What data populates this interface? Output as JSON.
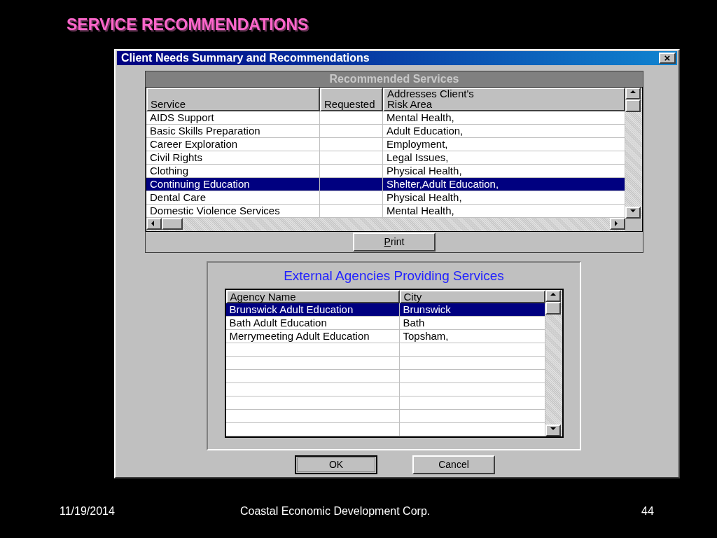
{
  "slide": {
    "title": "SERVICE RECOMMENDATIONS",
    "footer_date": "11/19/2014",
    "footer_org": "Coastal Economic Development Corp.",
    "footer_page": "44"
  },
  "window": {
    "title": "Client Needs Summary and Recommendations",
    "close": "×"
  },
  "services": {
    "heading": "Recommended Services",
    "columns": [
      "Service",
      "Requested",
      "Addresses Client's\nRisk Area"
    ],
    "rows": [
      {
        "cells": [
          "AIDS Support",
          "",
          "Mental Health,"
        ],
        "selected": false
      },
      {
        "cells": [
          "Basic Skills Preparation",
          "",
          "Adult Education,"
        ],
        "selected": false
      },
      {
        "cells": [
          "Career Exploration",
          "",
          "Employment,"
        ],
        "selected": false
      },
      {
        "cells": [
          "Civil Rights",
          "",
          "Legal Issues,"
        ],
        "selected": false
      },
      {
        "cells": [
          "Clothing",
          "",
          "Physical Health,"
        ],
        "selected": false
      },
      {
        "cells": [
          "Continuing Education",
          "",
          "Shelter,Adult Education,"
        ],
        "selected": true
      },
      {
        "cells": [
          "Dental Care",
          "",
          "Physical Health,"
        ],
        "selected": false
      },
      {
        "cells": [
          "Domestic Violence Services",
          "",
          "Mental Health,"
        ],
        "selected": false
      }
    ],
    "print_button": "Print"
  },
  "agencies": {
    "heading": "External Agencies Providing Services",
    "columns": [
      "Agency Name",
      "City"
    ],
    "rows": [
      {
        "cells": [
          "Brunswick Adult Education",
          "Brunswick"
        ],
        "selected": true
      },
      {
        "cells": [
          "Bath Adult Education",
          "Bath"
        ],
        "selected": false
      },
      {
        "cells": [
          "Merrymeeting Adult Education",
          "Topsham,"
        ],
        "selected": false
      }
    ]
  },
  "buttons": [
    "OK",
    "Cancel"
  ]
}
